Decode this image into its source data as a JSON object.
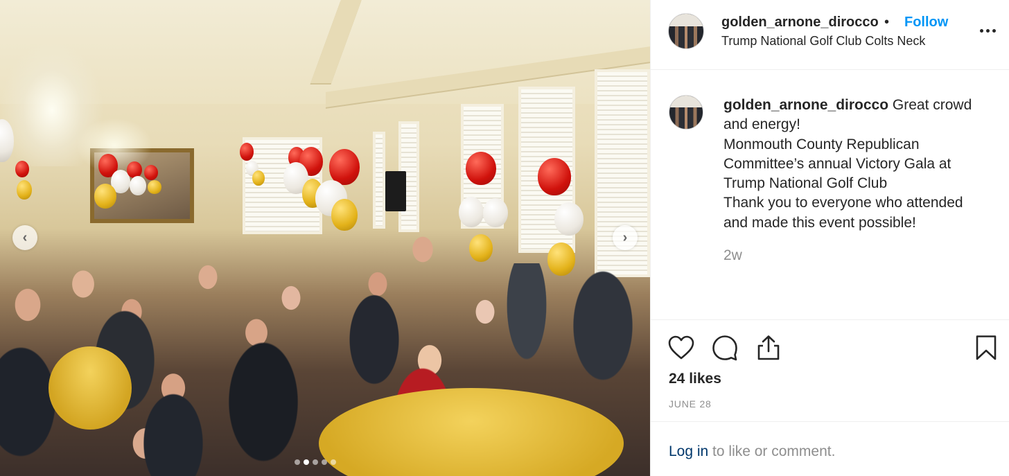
{
  "post": {
    "username": "golden_arnone_dirocco",
    "separator": "•",
    "follow_label": "Follow",
    "location": "Trump National Golf Club Colts Neck"
  },
  "caption": {
    "username": "golden_arnone_dirocco",
    "lines": [
      "Great crowd",
      "and energy!",
      "Monmouth County Republican",
      "Committee’s annual Victory Gala at",
      "Trump National Golf Club",
      "Thank you to everyone who attended",
      "and made this event possible!"
    ],
    "time_ago": "2w"
  },
  "engagement": {
    "likes": "24 likes",
    "date": "JUNE 28"
  },
  "footer": {
    "login_link": "Log in",
    "login_rest": " to like or comment."
  },
  "carousel": {
    "slide_count": 5,
    "active_slide": 2
  },
  "icons": {
    "like": "heart-icon",
    "comment": "comment-icon",
    "share": "share-icon",
    "save": "bookmark-icon",
    "more": "more-icon",
    "prev": "chevron-left-icon",
    "next": "chevron-right-icon"
  },
  "colors": {
    "follow_blue": "#0095f6",
    "link_dark_blue": "#00376b",
    "muted_gray": "#8e8e8e",
    "text_dark": "#262626"
  }
}
